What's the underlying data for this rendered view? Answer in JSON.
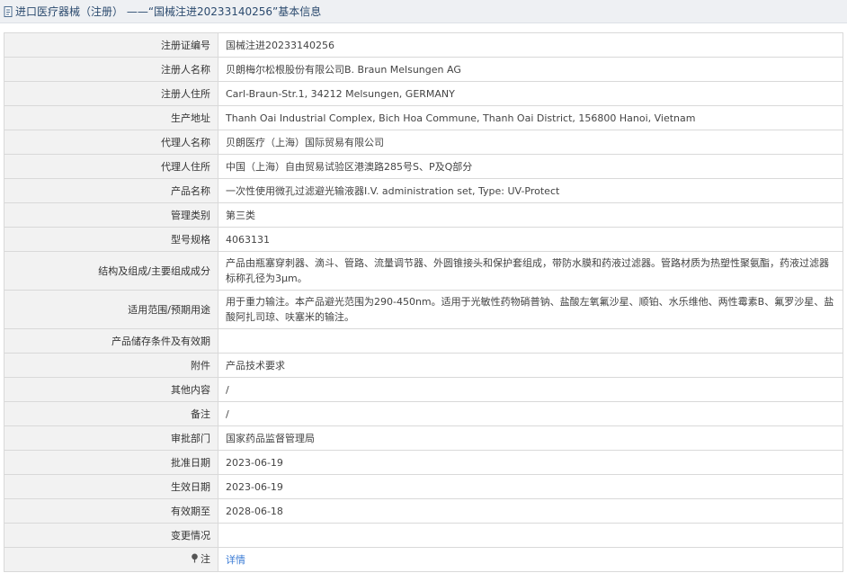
{
  "header": {
    "title": "进口医疗器械（注册） ——“国械注进20233140256”基本信息"
  },
  "rows": [
    {
      "label": "注册证编号",
      "value": "国械注进20233140256"
    },
    {
      "label": "注册人名称",
      "value": "贝朗梅尔松根股份有限公司B. Braun Melsungen AG"
    },
    {
      "label": "注册人住所",
      "value": "Carl-Braun-Str.1, 34212 Melsungen, GERMANY"
    },
    {
      "label": "生产地址",
      "value": "Thanh Oai Industrial Complex, Bich Hoa Commune, Thanh Oai District, 156800 Hanoi, Vietnam"
    },
    {
      "label": "代理人名称",
      "value": "贝朗医疗（上海）国际贸易有限公司"
    },
    {
      "label": "代理人住所",
      "value": "中国（上海）自由贸易试验区港澳路285号S、P及Q部分"
    },
    {
      "label": "产品名称",
      "value": "一次性使用微孔过滤避光输液器I.V. administration set, Type: UV-Protect"
    },
    {
      "label": "管理类别",
      "value": "第三类"
    },
    {
      "label": "型号规格",
      "value": "4063131"
    },
    {
      "label": "结构及组成/主要组成成分",
      "value": "产品由瓶塞穿刺器、滴斗、管路、流量调节器、外圆锥接头和保护套组成，带防水膜和药液过滤器。管路材质为热塑性聚氨酯，药液过滤器标称孔径为3μm。"
    },
    {
      "label": "适用范围/预期用途",
      "value": "用于重力输注。本产品避光范围为290-450nm。适用于光敏性药物硝普钠、盐酸左氧氟沙星、顺铂、水乐维他、两性霉素B、氟罗沙星、盐酸阿扎司琼、呋塞米的输注。"
    },
    {
      "label": "产品储存条件及有效期",
      "value": ""
    },
    {
      "label": "附件",
      "value": "产品技术要求"
    },
    {
      "label": "其他内容",
      "value": "/"
    },
    {
      "label": "备注",
      "value": "/"
    },
    {
      "label": "审批部门",
      "value": "国家药品监督管理局"
    },
    {
      "label": "批准日期",
      "value": "2023-06-19"
    },
    {
      "label": "生效日期",
      "value": "2023-06-19"
    },
    {
      "label": "有效期至",
      "value": "2028-06-18"
    },
    {
      "label": "变更情况",
      "value": ""
    }
  ],
  "note": {
    "label": "注",
    "icon": "pin-icon",
    "link_text": "详情"
  }
}
